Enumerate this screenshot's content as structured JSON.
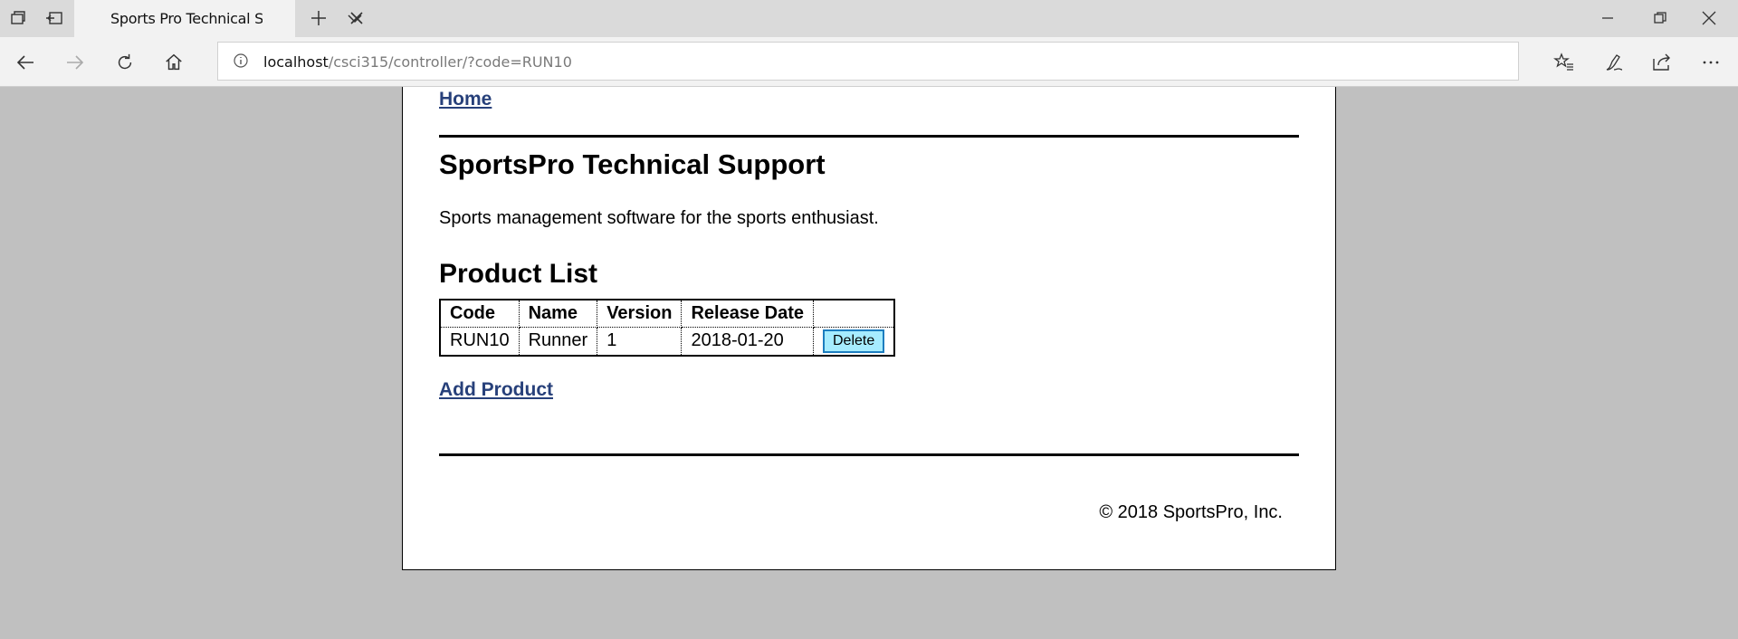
{
  "browser": {
    "tab_title": "Sports Pro Technical Sup",
    "address": {
      "host": "localhost",
      "path": "/csci315/controller/?code=RUN10"
    }
  },
  "page": {
    "home_link": "Home",
    "title": "SportsPro Technical Support",
    "tagline": "Sports management software for the sports enthusiast.",
    "section_title": "Product List",
    "table": {
      "headers": [
        "Code",
        "Name",
        "Version",
        "Release Date",
        ""
      ],
      "rows": [
        {
          "code": "RUN10",
          "name": "Runner",
          "version": "1",
          "release_date": "2018-01-20",
          "action": "Delete"
        }
      ]
    },
    "add_link": "Add Product",
    "footer": "© 2018 SportsPro, Inc."
  },
  "colors": {
    "link": "#27407a",
    "delete_button_bg": "#a6ecff",
    "page_background": "#c0c0c0"
  },
  "icons": [
    "tab-list-icon",
    "set-aside-tabs-icon",
    "close-icon",
    "new-tab-icon",
    "chevron-down-icon",
    "minimize-icon",
    "restore-icon",
    "back-icon",
    "forward-icon",
    "refresh-icon",
    "home-icon",
    "info-icon",
    "favorites-icon",
    "pen-icon",
    "share-icon",
    "more-icon"
  ]
}
